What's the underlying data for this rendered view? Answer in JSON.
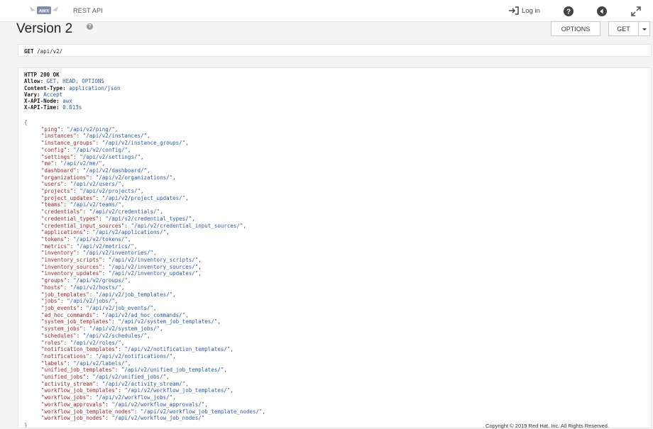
{
  "header": {
    "logo_text": "AWX",
    "app_title": "REST API",
    "login_label": "Log in"
  },
  "page": {
    "title": "Version 2",
    "options_button": "OPTIONS",
    "get_button": "GET"
  },
  "request": {
    "method": "GET",
    "path": "/api/v2/"
  },
  "response": {
    "status": "HTTP 200 OK",
    "headers": [
      {
        "key": "Allow:",
        "value": "GET, HEAD, OPTIONS"
      },
      {
        "key": "Content-Type:",
        "value": "application/json"
      },
      {
        "key": "Vary:",
        "value": "Accept"
      },
      {
        "key": "X-API-Node:",
        "value": "awx"
      },
      {
        "key": "X-API-Time:",
        "value": "0.013s"
      }
    ],
    "open_brace": "{",
    "close_brace": "}",
    "entries": [
      {
        "key": "\"ping\"",
        "value": "\"/api/v2/ping/\"",
        "sep": ","
      },
      {
        "key": "\"instances\"",
        "value": "\"/api/v2/instances/\"",
        "sep": ","
      },
      {
        "key": "\"instance_groups\"",
        "value": "\"/api/v2/instance_groups/\"",
        "sep": ","
      },
      {
        "key": "\"config\"",
        "value": "\"/api/v2/config/\"",
        "sep": ","
      },
      {
        "key": "\"settings\"",
        "value": "\"/api/v2/settings/\"",
        "sep": ","
      },
      {
        "key": "\"me\"",
        "value": "\"/api/v2/me/\"",
        "sep": ","
      },
      {
        "key": "\"dashboard\"",
        "value": "\"/api/v2/dashboard/\"",
        "sep": ","
      },
      {
        "key": "\"organizations\"",
        "value": "\"/api/v2/organizations/\"",
        "sep": ","
      },
      {
        "key": "\"users\"",
        "value": "\"/api/v2/users/\"",
        "sep": ","
      },
      {
        "key": "\"projects\"",
        "value": "\"/api/v2/projects/\"",
        "sep": ","
      },
      {
        "key": "\"project_updates\"",
        "value": "\"/api/v2/project_updates/\"",
        "sep": ","
      },
      {
        "key": "\"teams\"",
        "value": "\"/api/v2/teams/\"",
        "sep": ","
      },
      {
        "key": "\"credentials\"",
        "value": "\"/api/v2/credentials/\"",
        "sep": ","
      },
      {
        "key": "\"credential_types\"",
        "value": "\"/api/v2/credential_types/\"",
        "sep": ","
      },
      {
        "key": "\"credential_input_sources\"",
        "value": "\"/api/v2/credential_input_sources/\"",
        "sep": ","
      },
      {
        "key": "\"applications\"",
        "value": "\"/api/v2/applications/\"",
        "sep": ","
      },
      {
        "key": "\"tokens\"",
        "value": "\"/api/v2/tokens/\"",
        "sep": ","
      },
      {
        "key": "\"metrics\"",
        "value": "\"/api/v2/metrics/\"",
        "sep": ","
      },
      {
        "key": "\"inventory\"",
        "value": "\"/api/v2/inventories/\"",
        "sep": ","
      },
      {
        "key": "\"inventory_scripts\"",
        "value": "\"/api/v2/inventory_scripts/\"",
        "sep": ","
      },
      {
        "key": "\"inventory_sources\"",
        "value": "\"/api/v2/inventory_sources/\"",
        "sep": ","
      },
      {
        "key": "\"inventory_updates\"",
        "value": "\"/api/v2/inventory_updates/\"",
        "sep": ","
      },
      {
        "key": "\"groups\"",
        "value": "\"/api/v2/groups/\"",
        "sep": ","
      },
      {
        "key": "\"hosts\"",
        "value": "\"/api/v2/hosts/\"",
        "sep": ","
      },
      {
        "key": "\"job_templates\"",
        "value": "\"/api/v2/job_templates/\"",
        "sep": ","
      },
      {
        "key": "\"jobs\"",
        "value": "\"/api/v2/jobs/\"",
        "sep": ","
      },
      {
        "key": "\"job_events\"",
        "value": "\"/api/v2/job_events/\"",
        "sep": ","
      },
      {
        "key": "\"ad_hoc_commands\"",
        "value": "\"/api/v2/ad_hoc_commands/\"",
        "sep": ","
      },
      {
        "key": "\"system_job_templates\"",
        "value": "\"/api/v2/system_job_templates/\"",
        "sep": ","
      },
      {
        "key": "\"system_jobs\"",
        "value": "\"/api/v2/system_jobs/\"",
        "sep": ","
      },
      {
        "key": "\"schedules\"",
        "value": "\"/api/v2/schedules/\"",
        "sep": ","
      },
      {
        "key": "\"roles\"",
        "value": "\"/api/v2/roles/\"",
        "sep": ","
      },
      {
        "key": "\"notification_templates\"",
        "value": "\"/api/v2/notification_templates/\"",
        "sep": ","
      },
      {
        "key": "\"notifications\"",
        "value": "\"/api/v2/notifications/\"",
        "sep": ","
      },
      {
        "key": "\"labels\"",
        "value": "\"/api/v2/labels/\"",
        "sep": ","
      },
      {
        "key": "\"unified_job_templates\"",
        "value": "\"/api/v2/unified_job_templates/\"",
        "sep": ","
      },
      {
        "key": "\"unified_jobs\"",
        "value": "\"/api/v2/unified_jobs/\"",
        "sep": ","
      },
      {
        "key": "\"activity_stream\"",
        "value": "\"/api/v2/activity_stream/\"",
        "sep": ","
      },
      {
        "key": "\"workflow_job_templates\"",
        "value": "\"/api/v2/workflow_job_templates/\"",
        "sep": ","
      },
      {
        "key": "\"workflow_jobs\"",
        "value": "\"/api/v2/workflow_jobs/\"",
        "sep": ","
      },
      {
        "key": "\"workflow_approvals\"",
        "value": "\"/api/v2/workflow_approvals/\"",
        "sep": ","
      },
      {
        "key": "\"workflow_job_template_nodes\"",
        "value": "\"/api/v2/workflow_job_template_nodes/\"",
        "sep": ","
      },
      {
        "key": "\"workflow_job_nodes\"",
        "value": "\"/api/v2/workflow_job_nodes/\"",
        "sep": ""
      }
    ]
  },
  "footer": {
    "copyright": "Copyright © 2019 Red Hat, Inc. All Rights Reserved."
  }
}
